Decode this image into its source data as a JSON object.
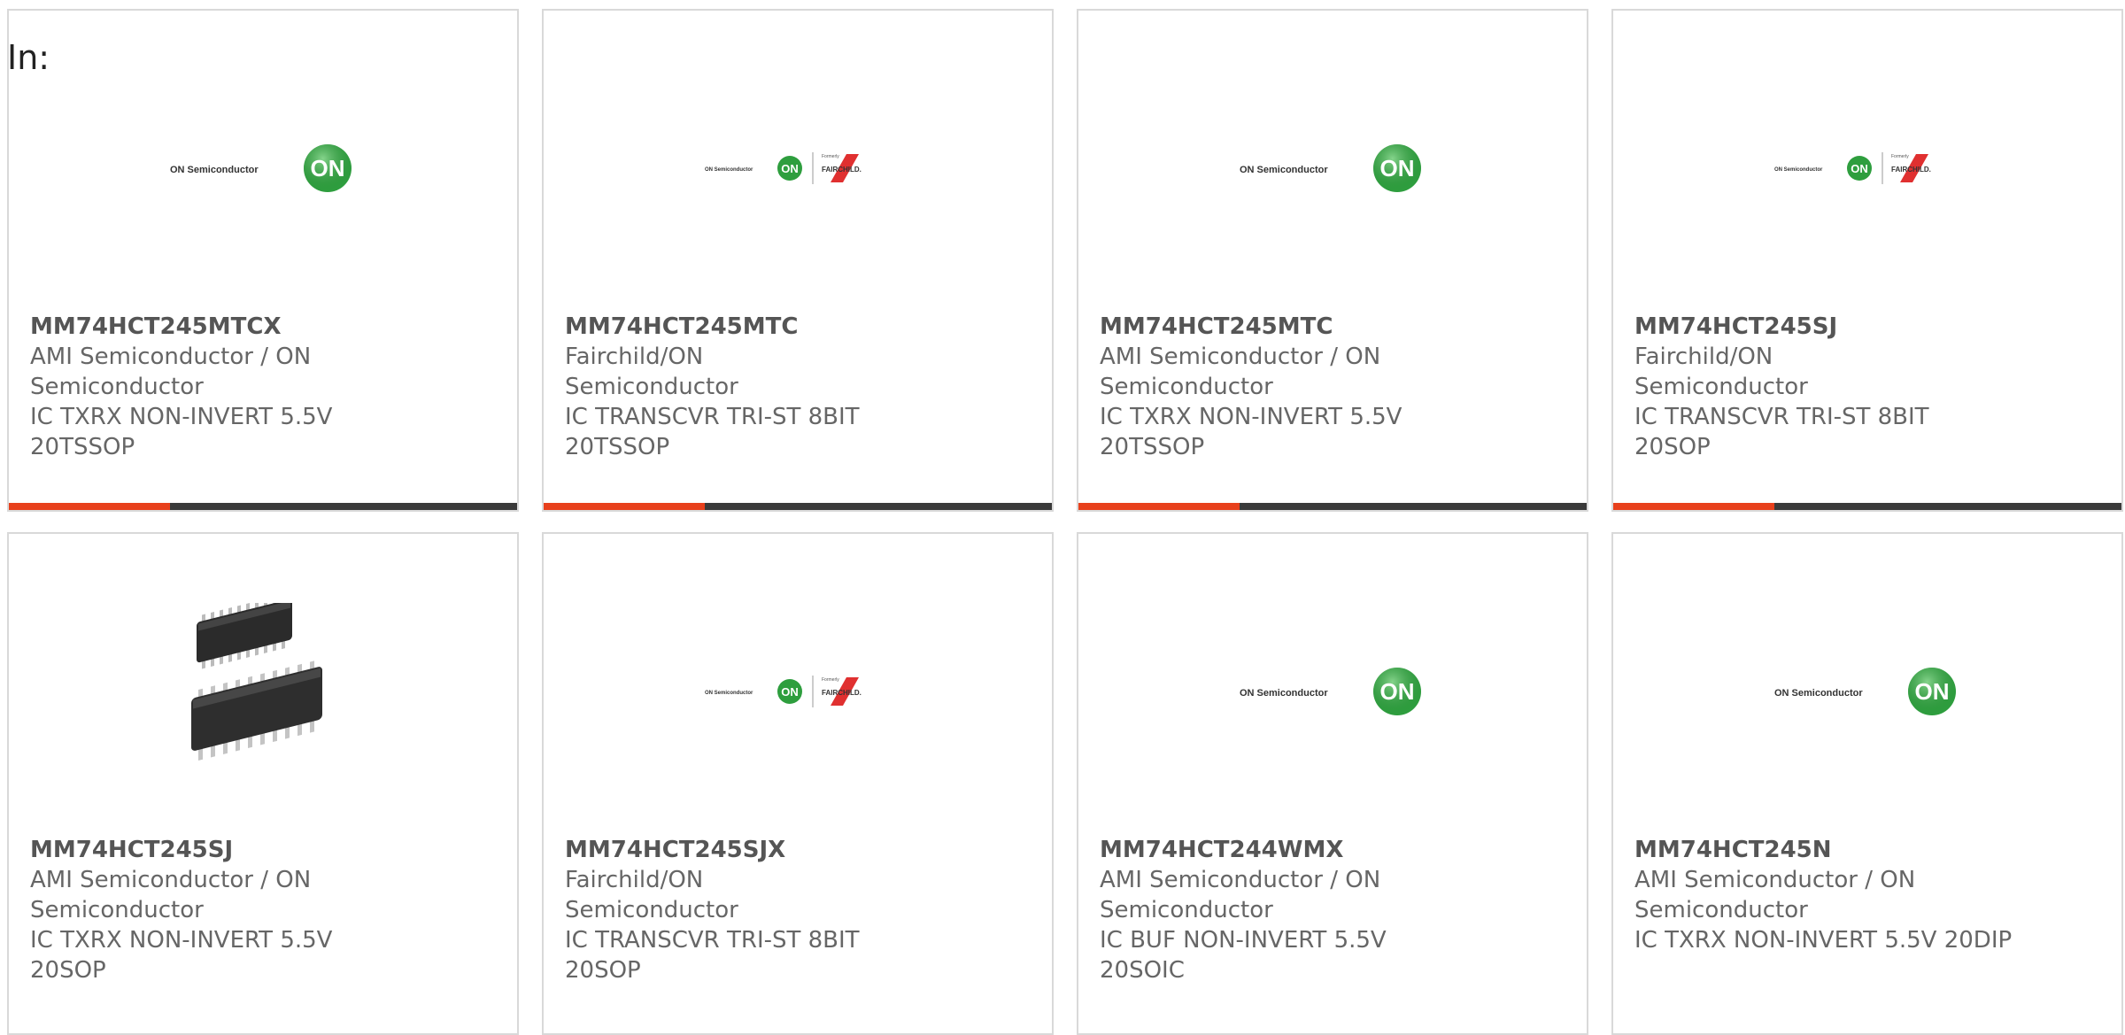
{
  "filter": {
    "in_label": "In:"
  },
  "logos": {
    "on_text": "ON Semiconductor",
    "on_mark": "ON",
    "formerly": "Formerly",
    "fairchild": "FAIRCHILD."
  },
  "colors": {
    "accent": "#e8401c",
    "bar_dark": "#3a3a3a",
    "on_green": "#2e9e3e",
    "fairchild_red": "#e03030"
  },
  "products": [
    {
      "part": "MM74HCT245MTCX",
      "lines": [
        "AMI Semiconductor / ON",
        "Semiconductor",
        "IC TXRX NON-INVERT 5.5V",
        "20TSSOP"
      ],
      "image": "on-logo"
    },
    {
      "part": "MM74HCT245MTC",
      "lines": [
        "Fairchild/ON Semiconductor",
        "IC TRANSCVR TRI-ST 8BIT",
        "20TSSOP"
      ],
      "image": "on-fairchild-logo"
    },
    {
      "part": "MM74HCT245MTC",
      "lines": [
        "AMI Semiconductor / ON",
        "Semiconductor",
        "IC TXRX NON-INVERT 5.5V",
        "20TSSOP"
      ],
      "image": "on-logo"
    },
    {
      "part": "MM74HCT245SJ",
      "lines": [
        "Fairchild/ON Semiconductor",
        "IC TRANSCVR TRI-ST 8BIT",
        "20SOP"
      ],
      "image": "on-fairchild-logo"
    },
    {
      "part": "MM74HCT245SJ",
      "lines": [
        "AMI Semiconductor / ON",
        "Semiconductor",
        "IC TXRX NON-INVERT 5.5V",
        "20SOP"
      ],
      "image": "chip-photo"
    },
    {
      "part": "MM74HCT245SJX",
      "lines": [
        "Fairchild/ON Semiconductor",
        "IC TRANSCVR TRI-ST 8BIT",
        "20SOP"
      ],
      "image": "on-fairchild-logo"
    },
    {
      "part": "MM74HCT244WMX",
      "lines": [
        "AMI Semiconductor / ON",
        "Semiconductor",
        "IC BUF NON-INVERT 5.5V",
        "20SOIC"
      ],
      "image": "on-logo"
    },
    {
      "part": "MM74HCT245N",
      "lines": [
        "AMI Semiconductor / ON",
        "Semiconductor",
        "IC TXRX NON-INVERT 5.5V 20DIP"
      ],
      "image": "on-logo"
    }
  ]
}
